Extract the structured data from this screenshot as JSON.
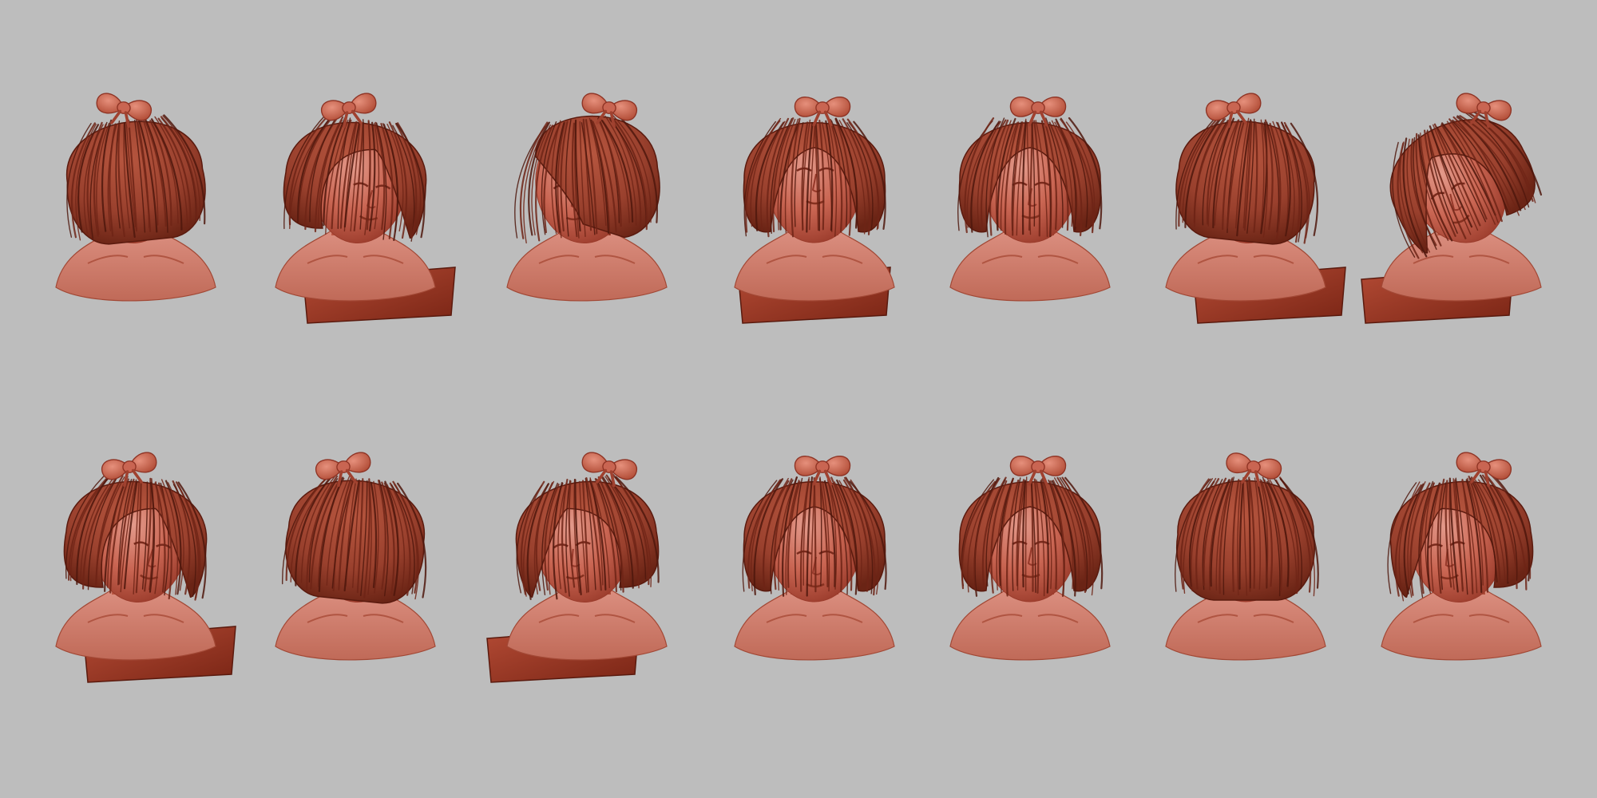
{
  "background_color": "#bdbdbd",
  "colors": {
    "skin_light": "#d98a7c",
    "skin_mid": "#c45f4c",
    "skin_dark": "#8e3324",
    "hair_base": "#a0412f",
    "hair_dark": "#6e2416",
    "hair_strand": "#4f180d",
    "cut_plane": "#b24a35",
    "cut_plane_dark": "#7c2616"
  },
  "gallery": {
    "rows": [
      {
        "views": [
          {
            "view": "back-left",
            "icon": "sculpt-bust-back-left"
          },
          {
            "view": "three-quarter-right",
            "icon": "sculpt-bust-three-quarter-right"
          },
          {
            "view": "profile-left",
            "icon": "sculpt-bust-profile-left"
          },
          {
            "view": "front-tilted-up",
            "icon": "sculpt-bust-front-tilted-up"
          },
          {
            "view": "front",
            "icon": "sculpt-bust-front"
          },
          {
            "view": "back-right",
            "icon": "sculpt-bust-back-right"
          },
          {
            "view": "tilted-left",
            "icon": "sculpt-bust-tilted-left"
          }
        ]
      },
      {
        "views": [
          {
            "view": "three-quarter-right",
            "icon": "sculpt-bust-three-quarter-right"
          },
          {
            "view": "back-right",
            "icon": "sculpt-bust-back-right"
          },
          {
            "view": "three-quarter-left",
            "icon": "sculpt-bust-three-quarter-left"
          },
          {
            "view": "front-tilted-down",
            "icon": "sculpt-bust-front-tilted-down"
          },
          {
            "view": "front",
            "icon": "sculpt-bust-front"
          },
          {
            "view": "top-down",
            "icon": "sculpt-bust-top-down"
          },
          {
            "view": "three-quarter-left",
            "icon": "sculpt-bust-three-quarter-left"
          }
        ]
      }
    ]
  }
}
